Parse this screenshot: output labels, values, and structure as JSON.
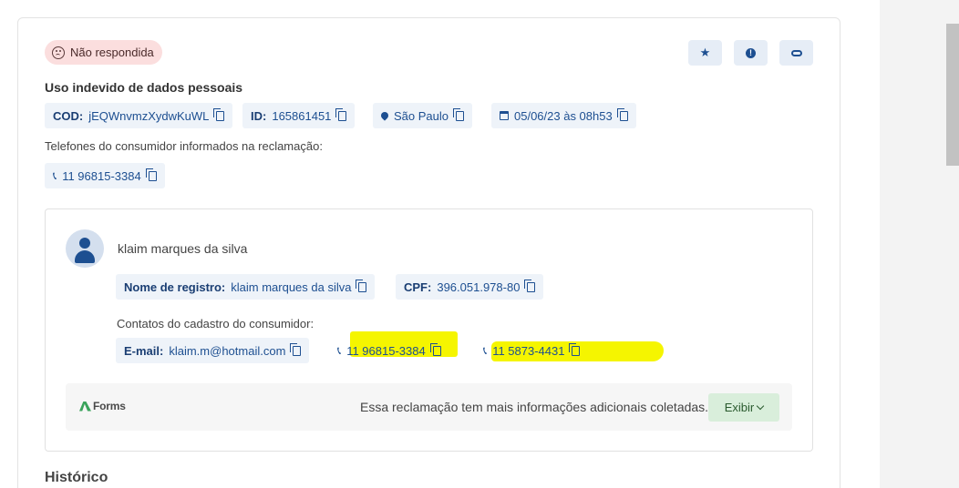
{
  "status": {
    "label": "Não respondida"
  },
  "actions": {
    "favorite_icon": "star-icon",
    "alert_icon": "alert-icon",
    "link_icon": "link-icon"
  },
  "complaint": {
    "title": "Uso indevido de dados pessoais",
    "cod_label": "COD:",
    "cod_value": "jEQWnvmzXydwKuWL",
    "id_label": "ID:",
    "id_value": "165861451",
    "location": "São Paulo",
    "datetime": "05/06/23 às 08h53",
    "phones_label": "Telefones do consumidor informados na reclamação:",
    "phone": "11 96815-3384"
  },
  "consumer": {
    "name": "klaim marques da silva",
    "registry_label": "Nome de registro:",
    "registry_value": "klaim marques da silva",
    "cpf_label": "CPF:",
    "cpf_value": "396.051.978-80",
    "contacts_label": "Contatos do cadastro do consumidor:",
    "email_label": "E-mail:",
    "email_value": "klaim.m@hotmail.com",
    "phone_1": "11 96815-3384",
    "phone_2": "11 5873-4431"
  },
  "forms": {
    "logo": "Forms",
    "message": "Essa reclamação tem mais informações adicionais coletadas.",
    "button": "Exibir"
  },
  "history": {
    "title": "Histórico"
  },
  "colors": {
    "accent": "#1d4f91",
    "badge_bg": "#fbdede",
    "chip_bg": "#eef3f9",
    "highlight": "#f5f500",
    "button_green": "#d9eedb"
  }
}
